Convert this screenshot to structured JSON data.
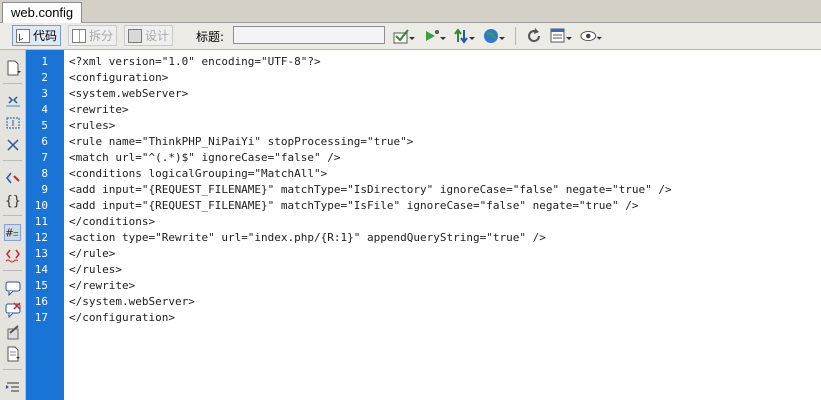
{
  "tab": {
    "label": "web.config"
  },
  "toolbar": {
    "code_label": "代码",
    "split_label": "拆分",
    "design_label": "设计",
    "title_label": "标题:",
    "title_value": ""
  },
  "code": {
    "line_numbers": [
      "1",
      "2",
      "3",
      "4",
      "5",
      "6",
      "7",
      "8",
      "9",
      "10",
      "11",
      "12",
      "13",
      "14",
      "15",
      "16",
      "17"
    ],
    "lines": [
      "<?xml version=\"1.0\" encoding=\"UTF-8\"?>",
      "<configuration>",
      "<system.webServer>",
      "<rewrite>",
      "<rules>",
      "<rule name=\"ThinkPHP_NiPaiYi\" stopProcessing=\"true\">",
      "<match url=\"^(.*)$\" ignoreCase=\"false\" />",
      "<conditions logicalGrouping=\"MatchAll\">",
      "<add input=\"{REQUEST_FILENAME}\" matchType=\"IsDirectory\" ignoreCase=\"false\" negate=\"true\" />",
      "<add input=\"{REQUEST_FILENAME}\" matchType=\"IsFile\" ignoreCase=\"false\" negate=\"true\" />",
      "</conditions>",
      "<action type=\"Rewrite\" url=\"index.php/{R:1}\" appendQueryString=\"true\" />",
      "</rule>",
      "</rules>",
      "</rewrite>",
      "</system.webServer>",
      "</configuration>"
    ]
  },
  "icons": {
    "toolbar": [
      "browser-check-icon",
      "preview-icon",
      "file-transfer-icon",
      "globe-icon",
      "refresh-icon",
      "view-options-icon",
      "visual-aids-icon"
    ],
    "left": [
      "open-documents-icon",
      "collapse-tag-icon",
      "collapse-selection-icon",
      "expand-all-icon",
      "select-parent-tag-icon",
      "balance-braces-icon",
      "line-numbers-icon",
      "highlight-invalid-icon",
      "apply-comment-icon",
      "remove-comment-icon",
      "wrap-tag-icon",
      "recent-snippets-icon",
      "indent-icon"
    ]
  },
  "colors": {
    "gutter": "#1a74d6",
    "tab_bg": "#d4d0c8",
    "toolbar_bg": "#ecebe6"
  }
}
